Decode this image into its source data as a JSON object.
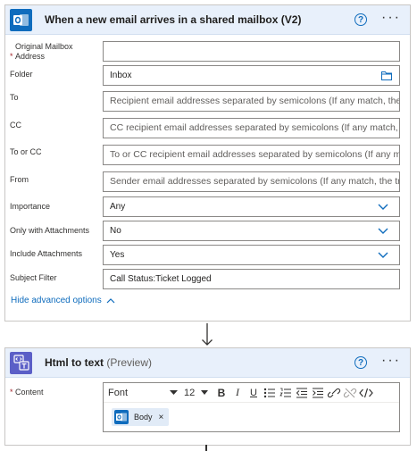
{
  "trigger": {
    "title": "When a new email arrives in a shared mailbox (V2)",
    "icon": "outlook-icon",
    "help": "?",
    "more": "···",
    "fields": {
      "mailbox": {
        "label": "Original Mailbox Address",
        "required_mark": "*",
        "value": ""
      },
      "folder": {
        "label": "Folder",
        "value": "Inbox",
        "icon": "folder-icon"
      },
      "to": {
        "label": "To",
        "placeholder": "Recipient email addresses separated by semicolons (If any match, the"
      },
      "cc": {
        "label": "CC",
        "placeholder": "CC recipient email addresses separated by semicolons (If any match,"
      },
      "to_or_cc": {
        "label": "To or CC",
        "placeholder": "To or CC recipient email addresses separated by semicolons (If any m"
      },
      "from": {
        "label": "From",
        "placeholder": "Sender email addresses separated by semicolons (If any match, the tr"
      },
      "importance": {
        "label": "Importance",
        "value": "Any"
      },
      "only_attachments": {
        "label": "Only with Attachments",
        "value": "No"
      },
      "include_attachments": {
        "label": "Include Attachments",
        "value": "Yes"
      },
      "subject_filter": {
        "label": "Subject Filter",
        "value": "Call Status:Ticket Logged"
      }
    },
    "hide_advanced": "Hide advanced options"
  },
  "action": {
    "title": "Html to text",
    "preview": "(Preview)",
    "icon": "html-icon",
    "help": "?",
    "more": "···",
    "content_label": "Content",
    "required_mark": "*",
    "toolbar": {
      "font": "Font",
      "size": "12",
      "bold": "B",
      "italic": "I",
      "underline": "U"
    },
    "token": {
      "label": "Body",
      "close": "×",
      "icon": "outlook-icon"
    }
  },
  "colors": {
    "accent": "#0f6cbd",
    "header_bg": "#e8f0fb",
    "html_icon": "#5b5fc7"
  }
}
